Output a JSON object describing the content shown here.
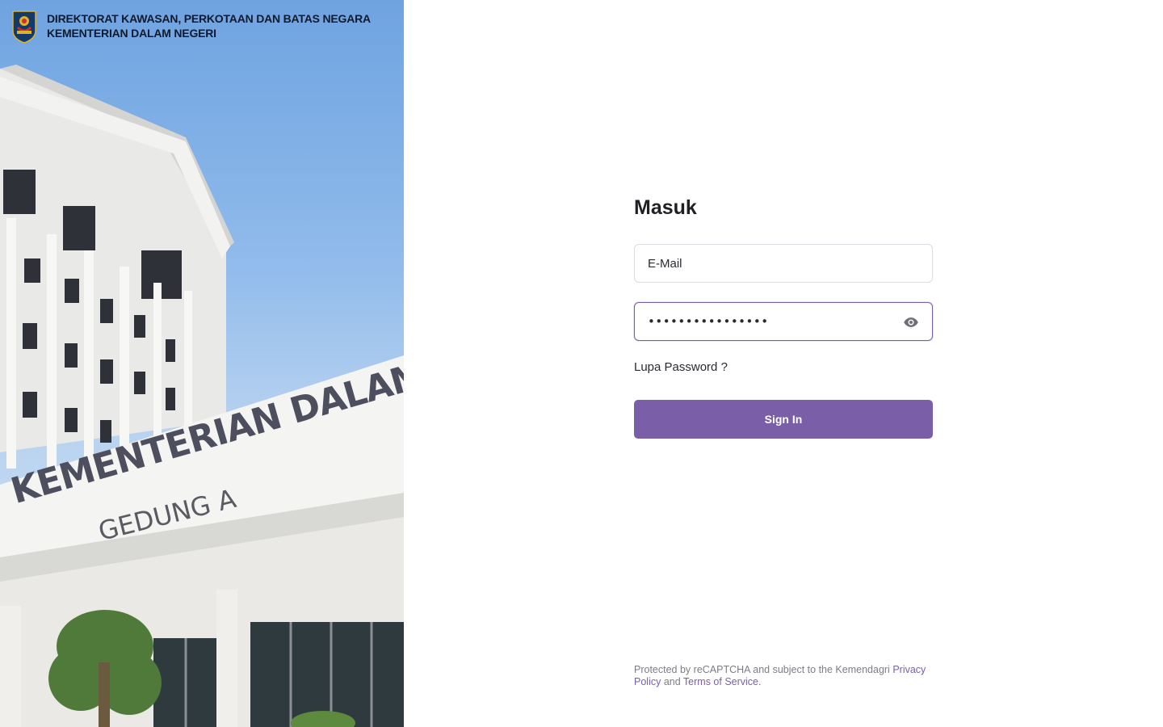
{
  "brand": {
    "line1": "DIREKTORAT KAWASAN, PERKOTAAN DAN BATAS NEGARA",
    "line2": "KEMENTERIAN DALAM NEGERI"
  },
  "hero": {
    "sign_line1": "KEMENTERIAN DALAM NEGERI",
    "sign_line2": "GEDUNG A"
  },
  "login": {
    "title": "Masuk",
    "email_placeholder": "E-Mail",
    "email_value": "",
    "password_value": "••••••••••••••••",
    "forgot_label": "Lupa Password ?",
    "submit_label": "Sign In"
  },
  "footer": {
    "text_prefix": "Protected by reCAPTCHA and subject to the Kemendagri ",
    "privacy_label": "Privacy Policy",
    "and_text": " and ",
    "terms_label": "Terms of Service",
    "suffix": "."
  },
  "colors": {
    "accent": "#7a5fa8",
    "text": "#1f1f24",
    "muted": "#7d7d86"
  },
  "icons": {
    "password_toggle": "eye-icon",
    "logo": "kemendagri-emblem"
  }
}
